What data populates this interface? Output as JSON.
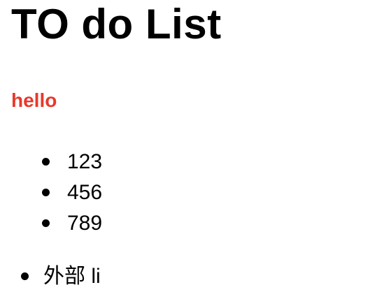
{
  "title": "TO do List",
  "subtitle": {
    "text": "hello",
    "color": "#e8392b"
  },
  "inner_list": {
    "items": [
      {
        "label": "123"
      },
      {
        "label": "456"
      },
      {
        "label": "789"
      }
    ]
  },
  "outer_list": {
    "items": [
      {
        "label": "外部 li"
      }
    ]
  },
  "icons": {
    "bullet": "disc-bullet-icon"
  }
}
